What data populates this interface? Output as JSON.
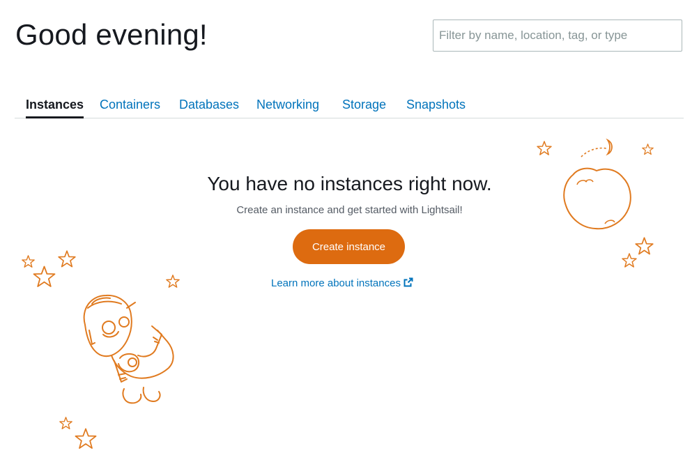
{
  "header": {
    "greeting": "Good evening!",
    "filter_placeholder": "Filter by name, location, tag, or type"
  },
  "tabs": [
    {
      "label": "Instances",
      "active": true
    },
    {
      "label": "Containers",
      "active": false
    },
    {
      "label": "Databases",
      "active": false
    },
    {
      "label": "Networking",
      "active": false
    },
    {
      "label": "Storage",
      "active": false
    },
    {
      "label": "Snapshots",
      "active": false
    }
  ],
  "empty_state": {
    "title": "You have no instances right now.",
    "subtitle": "Create an instance and get started with Lightsail!",
    "create_button": "Create instance",
    "learn_more": "Learn more about instances"
  },
  "colors": {
    "accent": "#dd6b10",
    "link": "#0073bb",
    "illustration": "#e07a1f"
  },
  "icons": {
    "external_link": "external-link-icon",
    "robot": "robot-illustration",
    "moon": "moon-illustration",
    "star": "star-icon"
  }
}
